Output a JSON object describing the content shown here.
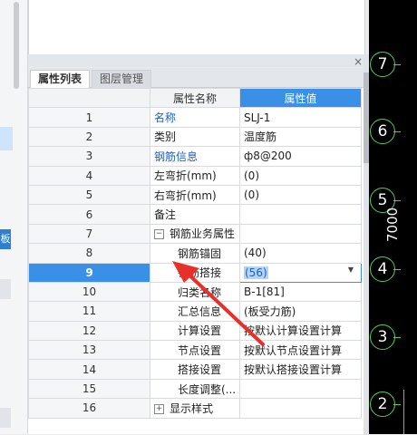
{
  "tabs": {
    "active": "属性列表",
    "inactive": "图层管理"
  },
  "close_glyph": "×",
  "columns": {
    "name": "属性名称",
    "value": "属性值"
  },
  "rows": [
    {
      "num": "1",
      "name": "名称",
      "value": "SLJ-1"
    },
    {
      "num": "2",
      "name": "类别",
      "value": "温度筋"
    },
    {
      "num": "3",
      "name": "钢筋信息",
      "value": "ф8@200"
    },
    {
      "num": "4",
      "name": "左弯折(mm)",
      "value": "(0)"
    },
    {
      "num": "5",
      "name": "右弯折(mm)",
      "value": "(0)"
    },
    {
      "num": "6",
      "name": "备注",
      "value": ""
    },
    {
      "num": "7",
      "name": "钢筋业务属性",
      "value": "",
      "tree": "−"
    },
    {
      "num": "8",
      "name": "钢筋锚固",
      "value": "(40)"
    },
    {
      "num": "9",
      "name": "钢筋搭接",
      "value": "(56)"
    },
    {
      "num": "10",
      "name": "归类名称",
      "value": "B-1[81]"
    },
    {
      "num": "11",
      "name": "汇总信息",
      "value": "(板受力筋)"
    },
    {
      "num": "12",
      "name": "计算设置",
      "value": "按默认计算设置计算"
    },
    {
      "num": "13",
      "name": "节点设置",
      "value": "按默认节点设置计算"
    },
    {
      "num": "14",
      "name": "搭接设置",
      "value": "按默认搭接设置计算"
    },
    {
      "num": "15",
      "name": "长度调整(...",
      "value": ""
    },
    {
      "num": "16",
      "name": "显示样式",
      "value": "",
      "tree": "+"
    }
  ],
  "left_tag": "板",
  "cad": {
    "axis_labels": [
      "7",
      "6",
      "5",
      "4",
      "3",
      "2"
    ],
    "dimension": "7000",
    "line_color": "#4fd14f"
  },
  "annotation_color": "#e8302a"
}
